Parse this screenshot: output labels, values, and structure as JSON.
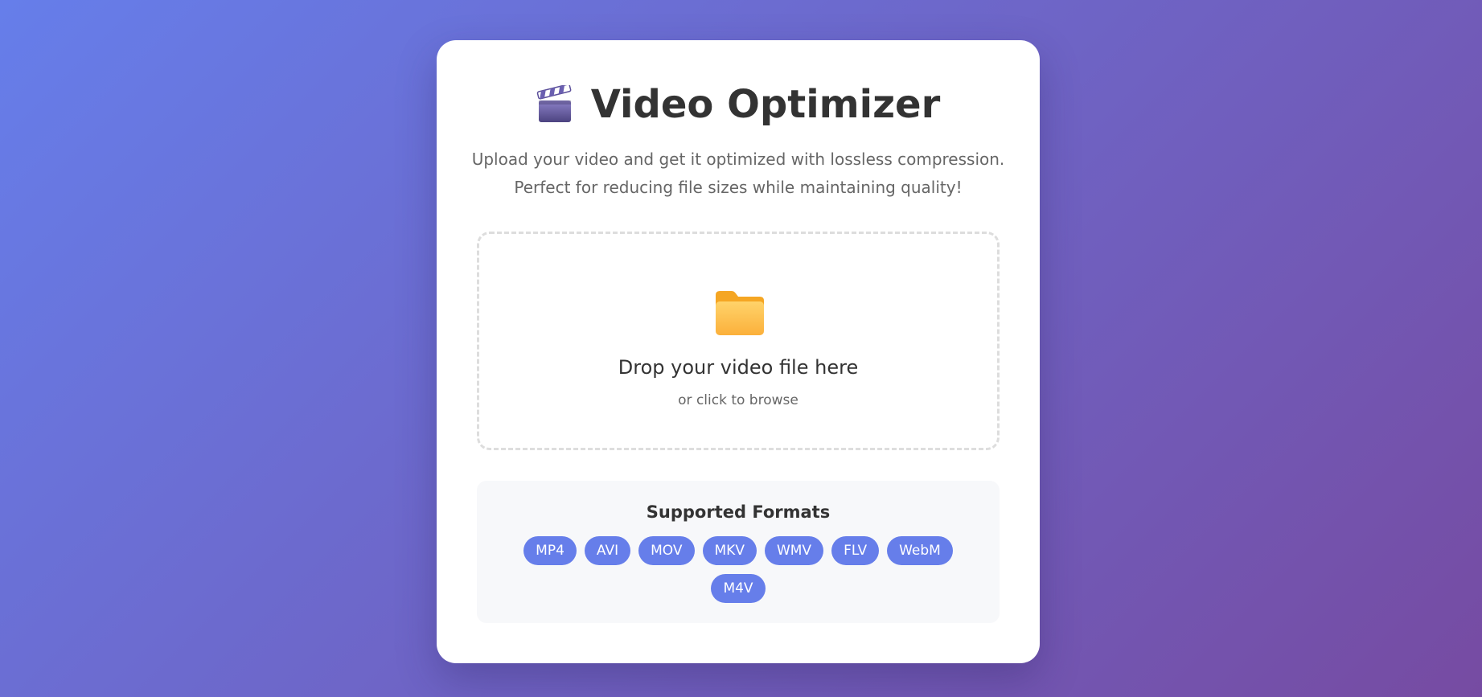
{
  "app": {
    "title": "Video Optimizer",
    "title_icon": "clapper-board-icon",
    "subtitle_line1": "Upload your video and get it optimized with lossless compression.",
    "subtitle_line2": "Perfect for reducing file sizes while maintaining quality!"
  },
  "dropzone": {
    "icon": "folder-icon",
    "title": "Drop your video file here",
    "subtitle": "or click to browse"
  },
  "formats": {
    "title": "Supported Formats",
    "items": [
      "MP4",
      "AVI",
      "MOV",
      "MKV",
      "WMV",
      "FLV",
      "WebM",
      "M4V"
    ]
  },
  "colors": {
    "background_start": "#667eea",
    "background_end": "#764ba2",
    "accent": "#667eea",
    "folder": "#fdbf4d"
  }
}
